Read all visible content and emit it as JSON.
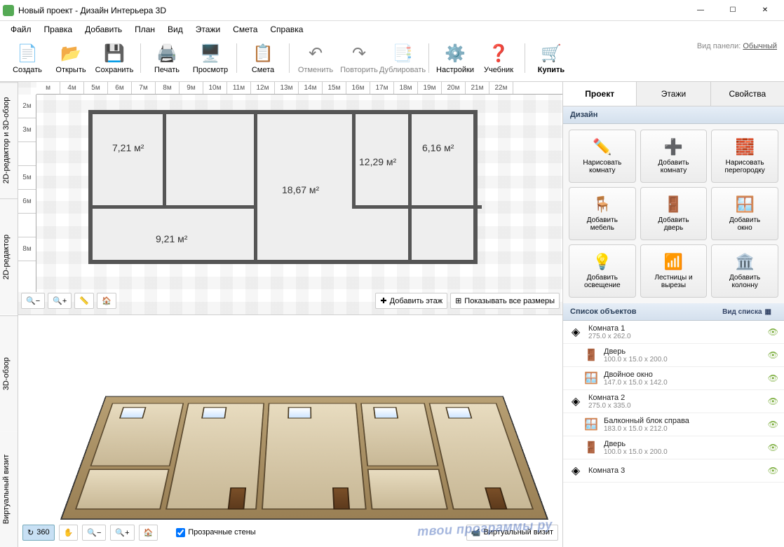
{
  "window": {
    "title": "Новый проект - Дизайн Интерьера 3D"
  },
  "menu": [
    "Файл",
    "Правка",
    "Добавить",
    "План",
    "Вид",
    "Этажи",
    "Смета",
    "Справка"
  ],
  "panel_mode": {
    "label": "Вид панели:",
    "value": "Обычный"
  },
  "toolbar": {
    "create": "Создать",
    "open": "Открыть",
    "save": "Сохранить",
    "print": "Печать",
    "preview": "Просмотр",
    "estimate": "Смета",
    "undo": "Отменить",
    "redo": "Повторить",
    "duplicate": "Дублировать",
    "settings": "Настройки",
    "tutorial": "Учебник",
    "buy": "Купить"
  },
  "left_tabs": [
    "2D-редактор и 3D-обзор",
    "2D-редактор",
    "3D-обзор",
    "Виртуальный визит"
  ],
  "ruler_h": [
    "м",
    "4м",
    "5м",
    "6м",
    "7м",
    "8м",
    "9м",
    "10м",
    "11м",
    "12м",
    "13м",
    "14м",
    "15м",
    "16м",
    "17м",
    "18м",
    "19м",
    "20м",
    "21м",
    "22м"
  ],
  "ruler_v": [
    "2м",
    "3м",
    "",
    "5м",
    "6м",
    "",
    "8м"
  ],
  "rooms": {
    "r1": "7,21 м²",
    "r2": "18,67 м²",
    "r3": "12,29 м²",
    "r4": "6,16 м²",
    "r5": "9,21 м²"
  },
  "fp_toolbar": {
    "add_floor": "Добавить этаж",
    "show_dims": "Показывать все размеры"
  },
  "fp3d_toolbar": {
    "rotate360": "360",
    "transparent_walls": "Прозрачные стены",
    "walkthrough": "Виртуальный визит"
  },
  "right": {
    "tabs": [
      "Проект",
      "Этажи",
      "Свойства"
    ],
    "section_design": "Дизайн",
    "buttons": [
      {
        "icon": "✏️",
        "label": "Нарисовать\nкомнату"
      },
      {
        "icon": "➕",
        "label": "Добавить\nкомнату"
      },
      {
        "icon": "🧱",
        "label": "Нарисовать\nперегородку"
      },
      {
        "icon": "🪑",
        "label": "Добавить\nмебель"
      },
      {
        "icon": "🚪",
        "label": "Добавить\nдверь"
      },
      {
        "icon": "🪟",
        "label": "Добавить\nокно"
      },
      {
        "icon": "💡",
        "label": "Добавить\nосвещение"
      },
      {
        "icon": "📶",
        "label": "Лестницы и\nвырезы"
      },
      {
        "icon": "🏛️",
        "label": "Добавить\nколонну"
      }
    ],
    "section_objects": "Список объектов",
    "list_mode": "Вид списка",
    "objects": [
      {
        "type": "room",
        "name": "Комната 1",
        "dim": "275.0 x 262.0",
        "child": false,
        "icon": "◈"
      },
      {
        "type": "door",
        "name": "Дверь",
        "dim": "100.0 x 15.0 x 200.0",
        "child": true,
        "icon": "🚪"
      },
      {
        "type": "window",
        "name": "Двойное окно",
        "dim": "147.0 x 15.0 x 142.0",
        "child": true,
        "icon": "🪟"
      },
      {
        "type": "room",
        "name": "Комната 2",
        "dim": "275.0 x 335.0",
        "child": false,
        "icon": "◈"
      },
      {
        "type": "balcony",
        "name": "Балконный блок справа",
        "dim": "183.0 x 15.0 x 212.0",
        "child": true,
        "icon": "🪟"
      },
      {
        "type": "door",
        "name": "Дверь",
        "dim": "100.0 x 15.0 x 200.0",
        "child": true,
        "icon": "🚪"
      },
      {
        "type": "room",
        "name": "Комната 3",
        "dim": "",
        "child": false,
        "icon": "◈"
      }
    ]
  },
  "watermark": "твои программы ру"
}
